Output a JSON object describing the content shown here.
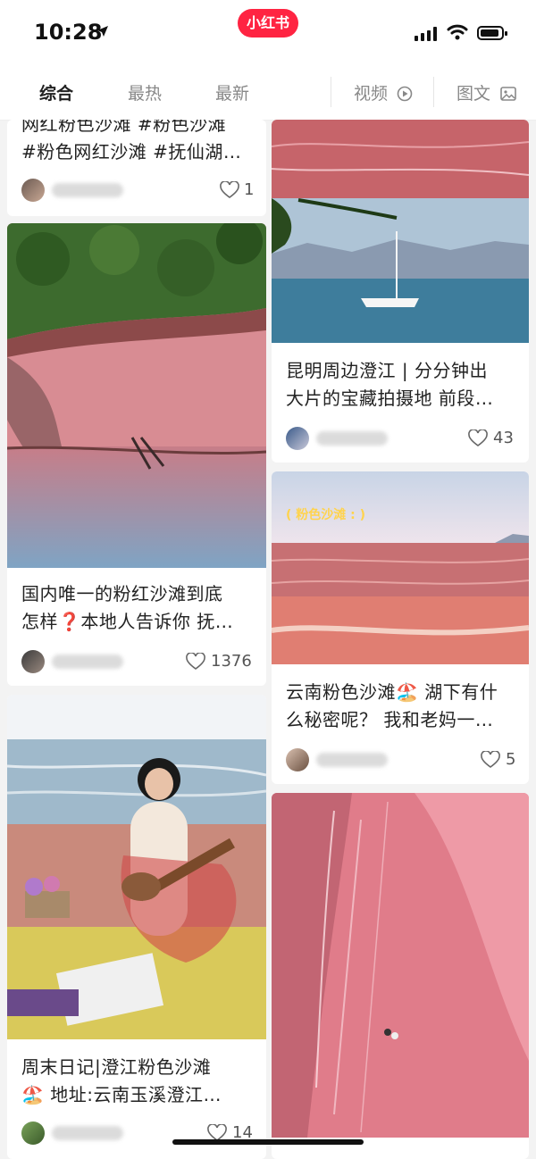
{
  "status": {
    "time": "10:28",
    "app_badge": "小红书"
  },
  "tabs": {
    "all": "综合",
    "hot": "最热",
    "new": "最新",
    "video": "视频",
    "image_text": "图文"
  },
  "cards": {
    "c1": {
      "line1": "网红粉色沙滩 #粉色沙滩",
      "line2": "#粉色网红沙滩 #抚仙湖…",
      "likes": "1"
    },
    "c2": {
      "line1": "国内唯一的粉红沙滩到底",
      "line2": "怎样❓本地人告诉你 抚…",
      "likes": "1376"
    },
    "c3": {
      "line1": "周末日记|澄江粉色沙滩",
      "line2": "🏖️ 地址:云南玉溪澄江…",
      "likes": "14"
    },
    "c4": {
      "line1": "昆明周边澄江 | 分分钟出",
      "line2": "大片的宝藏拍摄地 前段…",
      "likes": "43"
    },
    "c5": {
      "overlay": "( 粉色沙滩 : )",
      "line1": "云南粉色沙滩🏖️ 湖下有什",
      "line2": "么秘密呢？ 我和老妈一…",
      "likes": "5"
    }
  },
  "colors": {
    "brand": "#ff2442",
    "pink_sand": "#d9808a",
    "lake_blue": "#6f9fbd"
  },
  "icons": [
    "location-arrow-icon",
    "signal-icon",
    "wifi-icon",
    "battery-icon",
    "play-circle-icon",
    "image-icon",
    "heart-icon"
  ]
}
